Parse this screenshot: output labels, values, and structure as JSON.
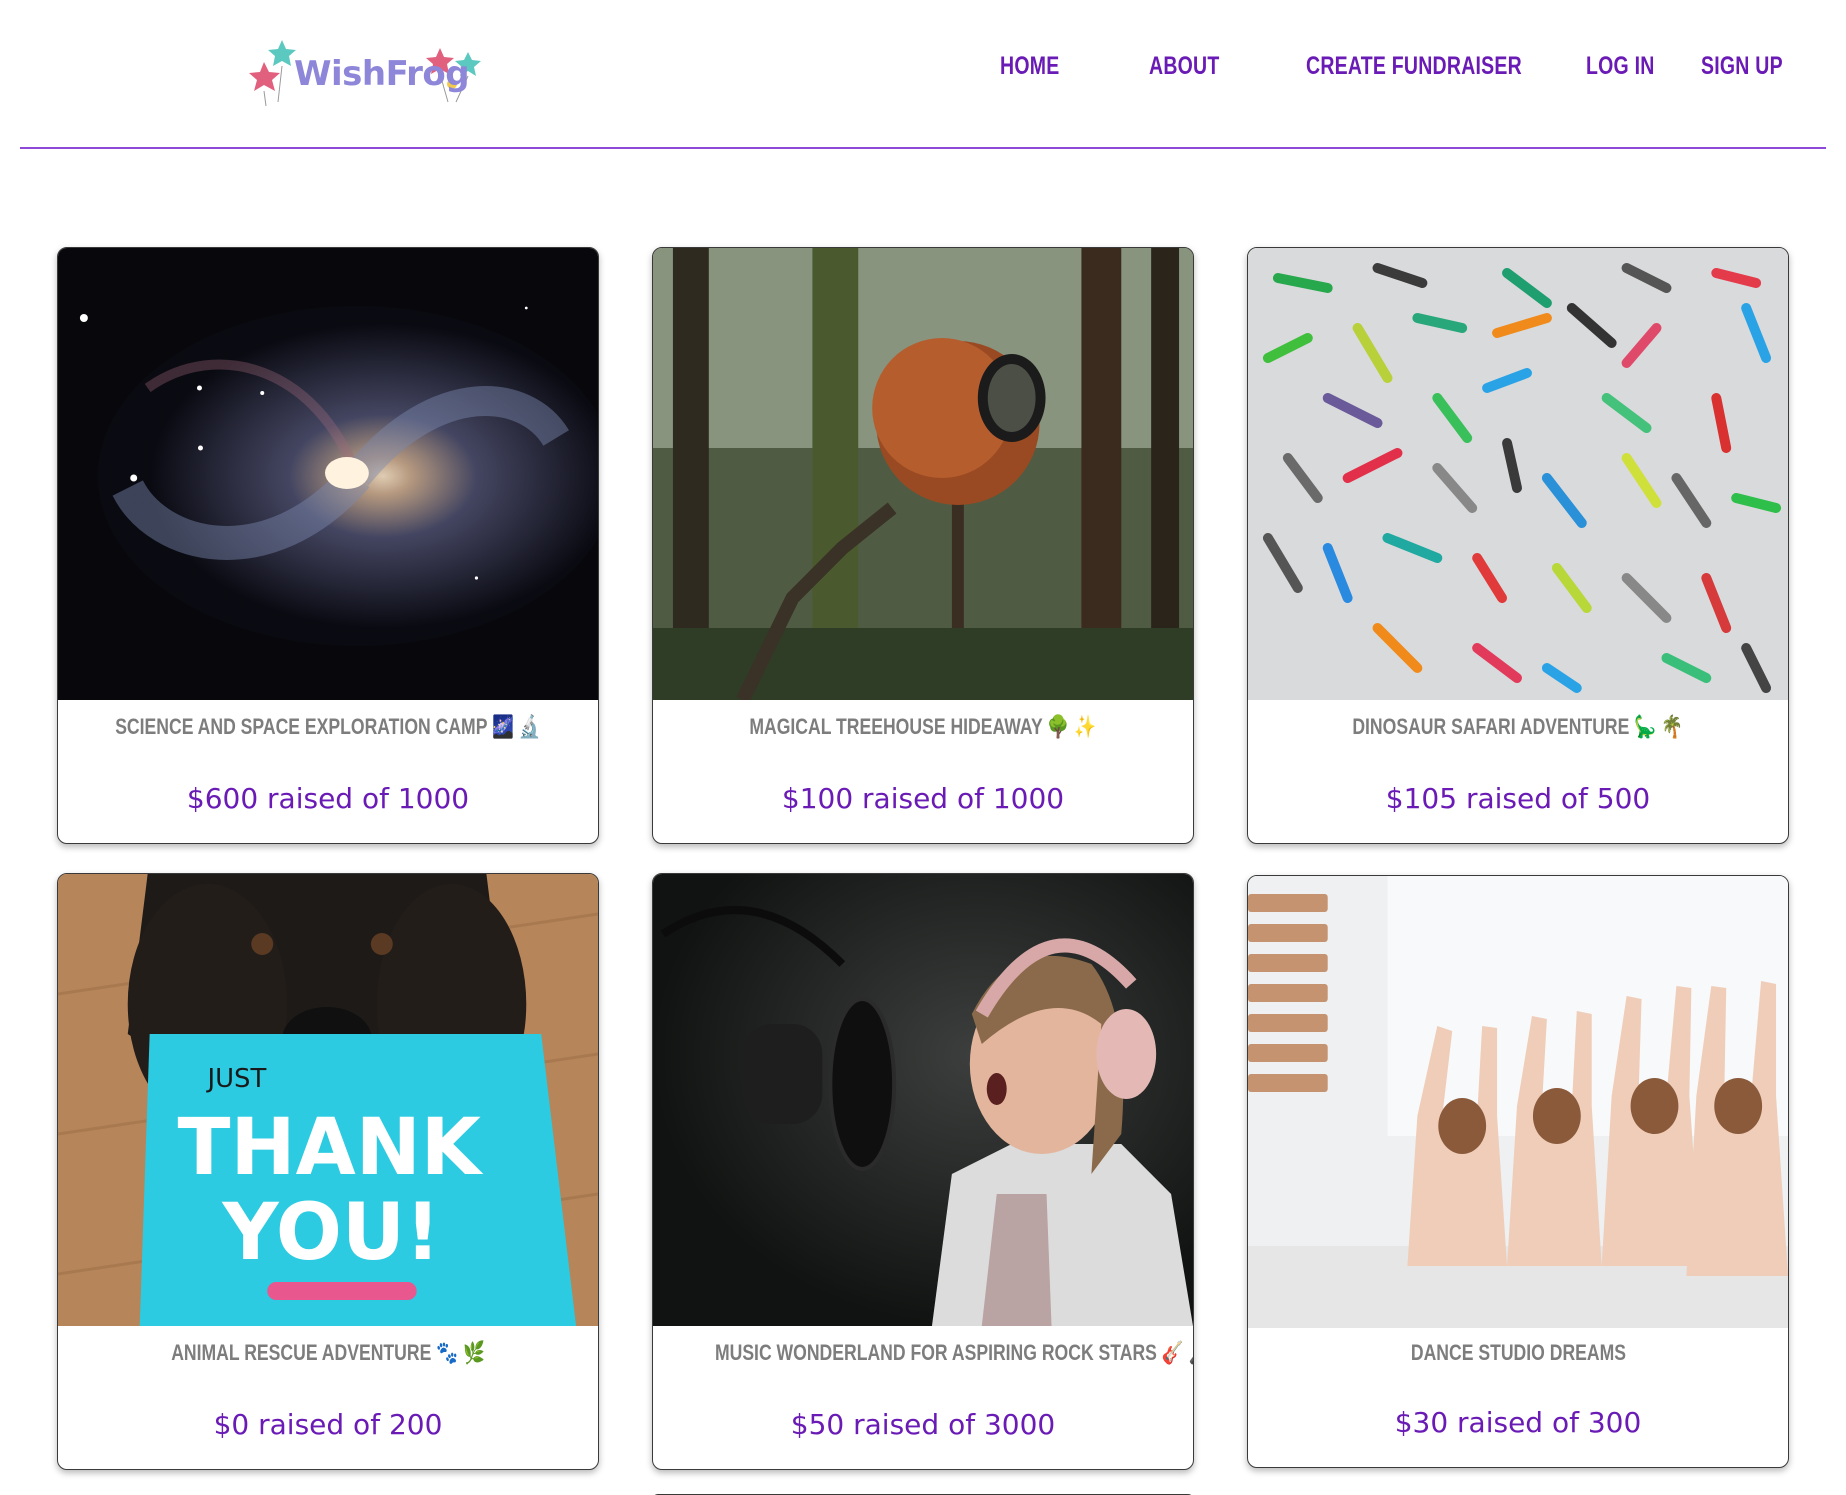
{
  "brand": {
    "name": "WishFrog"
  },
  "nav": {
    "home": "Home",
    "about": "About",
    "create": "Create Fundraiser",
    "login": "Log In",
    "signup": "Sign Up"
  },
  "colors": {
    "accent": "#6a1bb5",
    "divider": "#8f49d9",
    "title_gray": "#7d7d7d",
    "logo_text": "#8d86d9"
  },
  "fundraisers": [
    {
      "title": "Science and Space Exploration Camp 🌌 🔬",
      "raised": "$600 raised of 1000",
      "image": "spiral-galaxy"
    },
    {
      "title": "Magical Treehouse Hideaway 🌳 ✨",
      "raised": "$100 raised of 1000",
      "image": "forest-sphere-treehouse"
    },
    {
      "title": "Dinosaur Safari Adventure 🦕 🌴",
      "raised": "$105 raised of 500",
      "image": "toy-dinosaurs"
    },
    {
      "title": "Animal Rescue Adventure 🐾 🌿",
      "raised": "$0 raised of 200",
      "image": "dog-thank-you-card",
      "image_text": {
        "line1": "JUST",
        "line2": "THANK",
        "line3": "YOU!"
      }
    },
    {
      "title": "Music Wonderland for Aspiring Rock Stars 🎸 🎤",
      "raised": "$50 raised of 3000",
      "image": "girl-singing-microphone"
    },
    {
      "title": "Dance Studio Dreams",
      "raised": "$30 raised of 300",
      "image": "ballet-dancers"
    }
  ]
}
